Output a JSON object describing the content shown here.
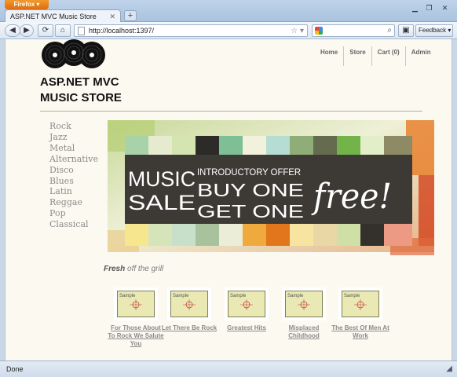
{
  "browser": {
    "menu_label": "Firefox",
    "tab_title": "ASP.NET MVC Music Store",
    "url": "http://localhost:1397/",
    "feedback_label": "Feedback",
    "status": "Done"
  },
  "site": {
    "title": "ASP.NET MVC MUSIC STORE",
    "nav": [
      "Home",
      "Store",
      "Cart (0)",
      "Admin"
    ]
  },
  "genres": [
    "Rock",
    "Jazz",
    "Metal",
    "Alternative",
    "Disco",
    "Blues",
    "Latin",
    "Reggae",
    "Pop",
    "Classical"
  ],
  "banner": {
    "word1": "MUSIC",
    "word2": "SALE",
    "offer": "INTRODUCTORY OFFER",
    "line1": "BUY ONE",
    "line2": "GET ONE",
    "free": "free!"
  },
  "fresh": {
    "bold": "Fresh",
    "rest": "off the grill"
  },
  "thumb_label": "Sample",
  "albums": [
    {
      "title": "For Those About To Rock We Salute You"
    },
    {
      "title": "Let There Be Rock"
    },
    {
      "title": "Greatest Hits"
    },
    {
      "title": "Misplaced Childhood"
    },
    {
      "title": "The Best Of Men At Work"
    }
  ]
}
